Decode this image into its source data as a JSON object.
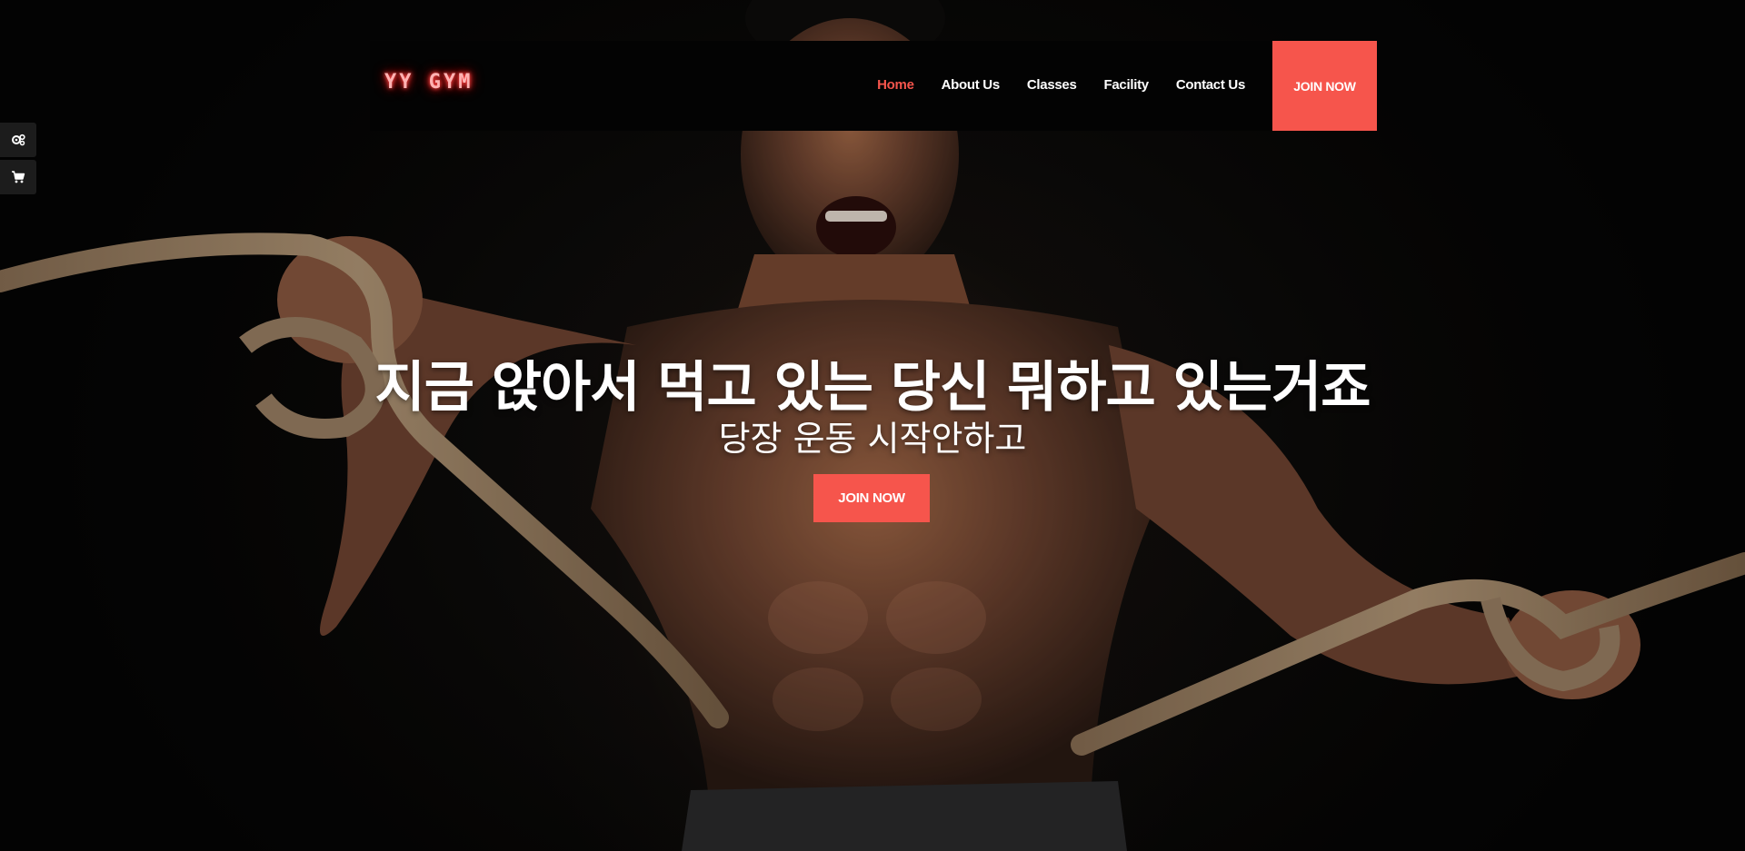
{
  "brand": {
    "logo_text": "YY GYM",
    "accent_color": "#f6554c",
    "logo_glow_color": "#ff2a2a"
  },
  "nav": {
    "items": [
      {
        "label": "Home",
        "active": true
      },
      {
        "label": "About Us",
        "active": false
      },
      {
        "label": "Classes",
        "active": false
      },
      {
        "label": "Facility",
        "active": false
      },
      {
        "label": "Contact Us",
        "active": false
      }
    ],
    "join_label": "JOIN NOW"
  },
  "side_tools": [
    {
      "icon": "gears-icon"
    },
    {
      "icon": "shopping-cart-icon"
    }
  ],
  "hero": {
    "title": "지금 앉아서 먹고 있는 당신 뭐하고 있는거죠",
    "subtitle": "당장 운동 시작안하고",
    "join_label": "JOIN NOW",
    "background": "muscular man pulling thick ropes on dark background"
  }
}
